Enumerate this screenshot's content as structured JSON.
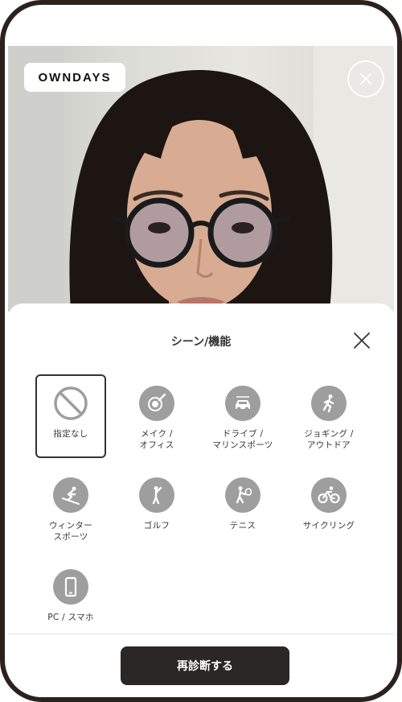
{
  "brand": {
    "logo_text": "OWNDAYS"
  },
  "panel": {
    "title": "シーン/機能",
    "selected_index": 0,
    "scenes": [
      {
        "label": "指定なし",
        "icon": "no-symbol-icon"
      },
      {
        "label": "メイク /\nオフィス",
        "icon": "makeup-icon"
      },
      {
        "label": "ドライブ /\nマリンスポーツ",
        "icon": "car-icon"
      },
      {
        "label": "ジョギング /\nアウトドア",
        "icon": "running-icon"
      },
      {
        "label": "ウィンター\nスポーツ",
        "icon": "ski-icon"
      },
      {
        "label": "ゴルフ",
        "icon": "golf-icon"
      },
      {
        "label": "テニス",
        "icon": "tennis-icon"
      },
      {
        "label": "サイクリング",
        "icon": "bicycle-icon"
      },
      {
        "label": "PC / スマホ",
        "icon": "smartphone-icon"
      }
    ]
  },
  "footer": {
    "button_label": "再診断する"
  },
  "colors": {
    "frame": "#2c211d",
    "icon_circle": "#9e9e9e",
    "button_bg": "#2a2726",
    "text": "#333333"
  }
}
